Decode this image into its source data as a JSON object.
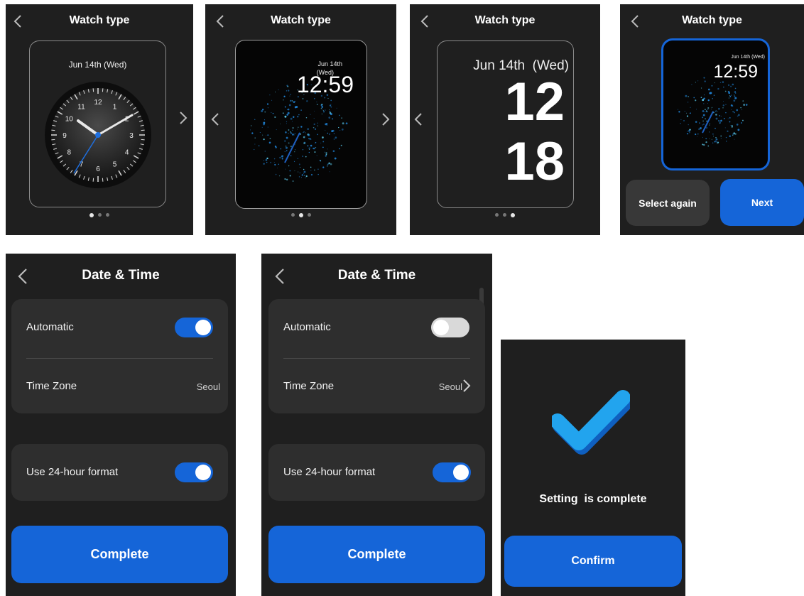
{
  "watch_type_screens": [
    {
      "title": "Watch type",
      "date": "Jun 14th (Wed)",
      "dial_numbers": [
        "12",
        "1",
        "2",
        "3",
        "4",
        "5",
        "6",
        "7",
        "8",
        "9",
        "10",
        "11"
      ],
      "page_index": 0
    },
    {
      "title": "Watch type",
      "date_line1": "Jun 14th",
      "date_line2": "(Wed)",
      "time": "12:59",
      "page_index": 1
    },
    {
      "title": "Watch type",
      "date": "Jun 14th  (Wed)",
      "hour": "12",
      "minute": "18",
      "page_index": 2
    },
    {
      "title": "Watch type",
      "date": "Jun 14th (Wed)",
      "time": "12:59",
      "select_again_label": "Select again",
      "next_label": "Next"
    }
  ],
  "date_time_screens": [
    {
      "title": "Date & Time",
      "automatic_label": "Automatic",
      "automatic_on": true,
      "timezone_label": "Time Zone",
      "timezone_value": "Seoul",
      "format_label": "Use 24-hour format",
      "format_on": true,
      "complete_label": "Complete"
    },
    {
      "title": "Date & Time",
      "automatic_label": "Automatic",
      "automatic_on": false,
      "timezone_label": "Time Zone",
      "timezone_value": "Seoul",
      "format_label": "Use 24-hour format",
      "format_on": true,
      "complete_label": "Complete"
    }
  ],
  "complete_screen": {
    "message": "Setting  is complete",
    "confirm_label": "Confirm"
  },
  "colors": {
    "background": "#1f1f1f",
    "card": "#2e2e2e",
    "accent": "#1565d8",
    "check": "#1e9be8"
  },
  "icons": [
    "back-chevron-icon",
    "next-chevron-icon",
    "checkmark-icon"
  ]
}
